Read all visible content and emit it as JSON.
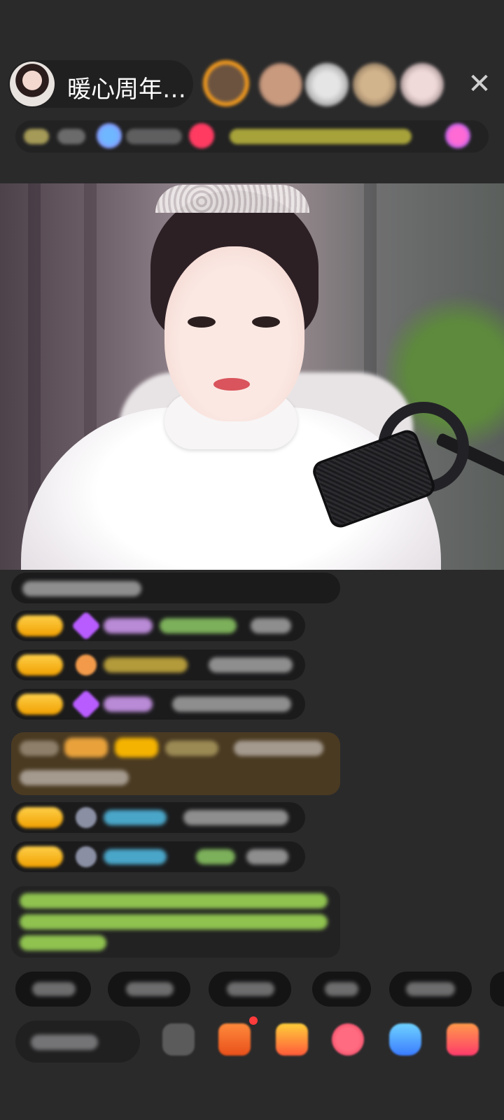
{
  "header": {
    "host_name": "暖心周年…",
    "close_icon": "close-icon"
  },
  "colors": {
    "background": "#2a2a2b",
    "badge_gold": "#f5b301",
    "chat_green": "#9fd36a",
    "chat_purple": "#c77bff",
    "chat_cyan": "#5ac8fa",
    "highlight_brown": "#4a3a22"
  },
  "icons": [
    "close-icon",
    "emoji-icon",
    "gift-box-icon",
    "treasure-chest-icon",
    "heart-red-icon",
    "gamepad-icon",
    "mall-icon"
  ]
}
